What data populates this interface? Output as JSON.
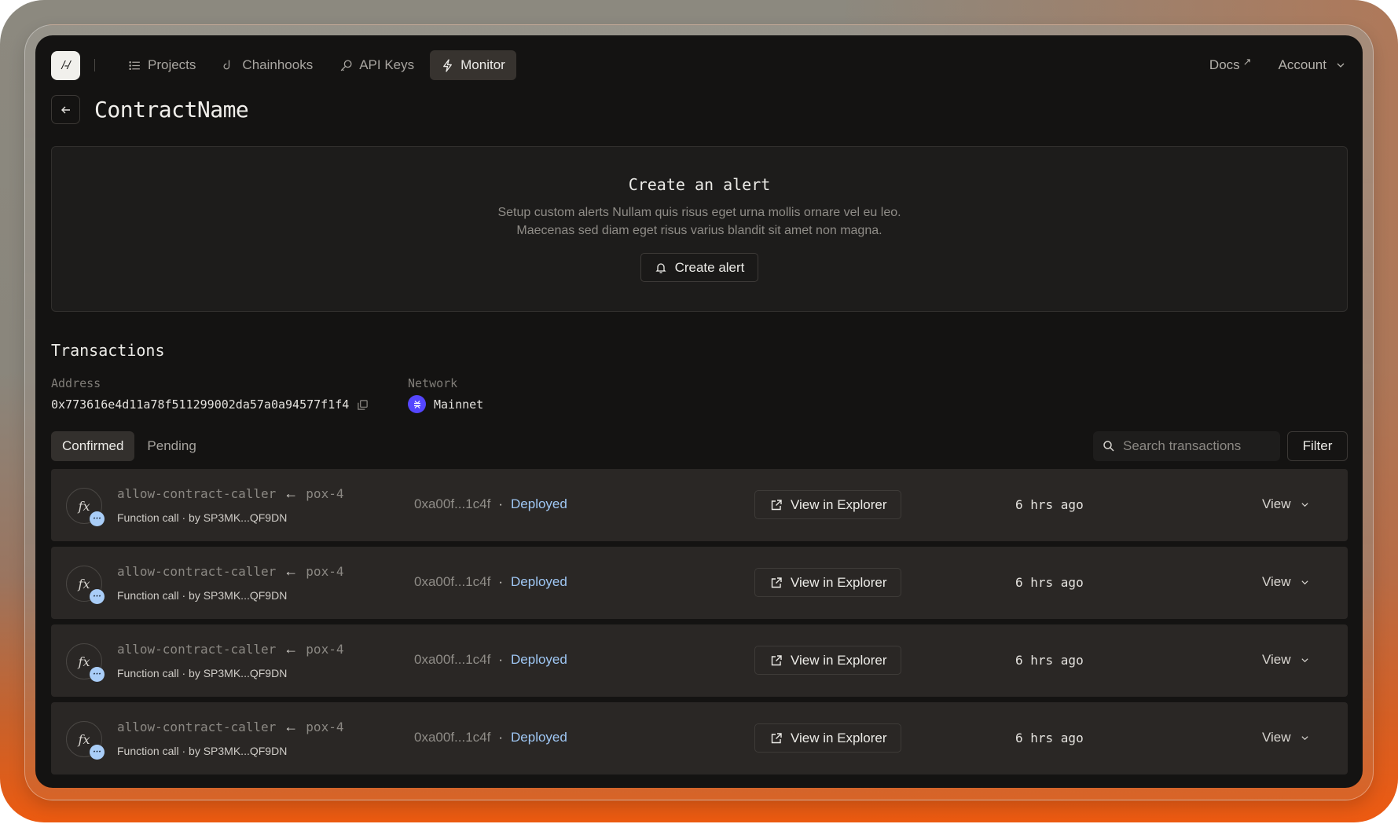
{
  "nav": {
    "logo": "/-/",
    "items": [
      {
        "label": "Projects",
        "icon": "list-icon",
        "active": false
      },
      {
        "label": "Chainhooks",
        "icon": "hook-icon",
        "active": false
      },
      {
        "label": "API Keys",
        "icon": "key-icon",
        "active": false
      },
      {
        "label": "Monitor",
        "icon": "bolt-icon",
        "active": true
      }
    ],
    "docs_label": "Docs",
    "docs_icon": "↗",
    "account_label": "Account"
  },
  "page": {
    "title": "ContractName"
  },
  "alert": {
    "title": "Create an alert",
    "desc_line1": "Setup custom alerts Nullam quis risus eget urna mollis ornare vel eu leo.",
    "desc_line2": "Maecenas sed diam eget risus varius blandit sit amet non magna.",
    "button_label": "Create alert"
  },
  "transactions": {
    "heading": "Transactions",
    "address_label": "Address",
    "address_value": "0x773616e4d11a78f511299002da57a0a94577f1f4",
    "network_label": "Network",
    "network_value": "Mainnet",
    "network_color": "#5546ff",
    "tabs": [
      {
        "label": "Confirmed",
        "active": true
      },
      {
        "label": "Pending",
        "active": false
      }
    ],
    "search_placeholder": "Search transactions",
    "filter_label": "Filter",
    "rows": [
      {
        "function": "allow-contract-caller",
        "contract": "pox-4",
        "type": "Function call",
        "by": "by SP3MK...QF9DN",
        "hash": "0xa00f...1c4f",
        "status": "Deployed",
        "explorer_label": "View in Explorer",
        "time": "6 hrs ago",
        "view_label": "View"
      },
      {
        "function": "allow-contract-caller",
        "contract": "pox-4",
        "type": "Function call",
        "by": "by SP3MK...QF9DN",
        "hash": "0xa00f...1c4f",
        "status": "Deployed",
        "explorer_label": "View in Explorer",
        "time": "6 hrs ago",
        "view_label": "View"
      },
      {
        "function": "allow-contract-caller",
        "contract": "pox-4",
        "type": "Function call",
        "by": "by SP3MK...QF9DN",
        "hash": "0xa00f...1c4f",
        "status": "Deployed",
        "explorer_label": "View in Explorer",
        "time": "6 hrs ago",
        "view_label": "View"
      },
      {
        "function": "allow-contract-caller",
        "contract": "pox-4",
        "type": "Function call",
        "by": "by SP3MK...QF9DN",
        "hash": "0xa00f...1c4f",
        "status": "Deployed",
        "explorer_label": "View in Explorer",
        "time": "6 hrs ago",
        "view_label": "View"
      }
    ]
  },
  "colors": {
    "accent_status": "#9fc7f4",
    "panel_bg": "#141312",
    "row_bg": "#2a2725"
  }
}
